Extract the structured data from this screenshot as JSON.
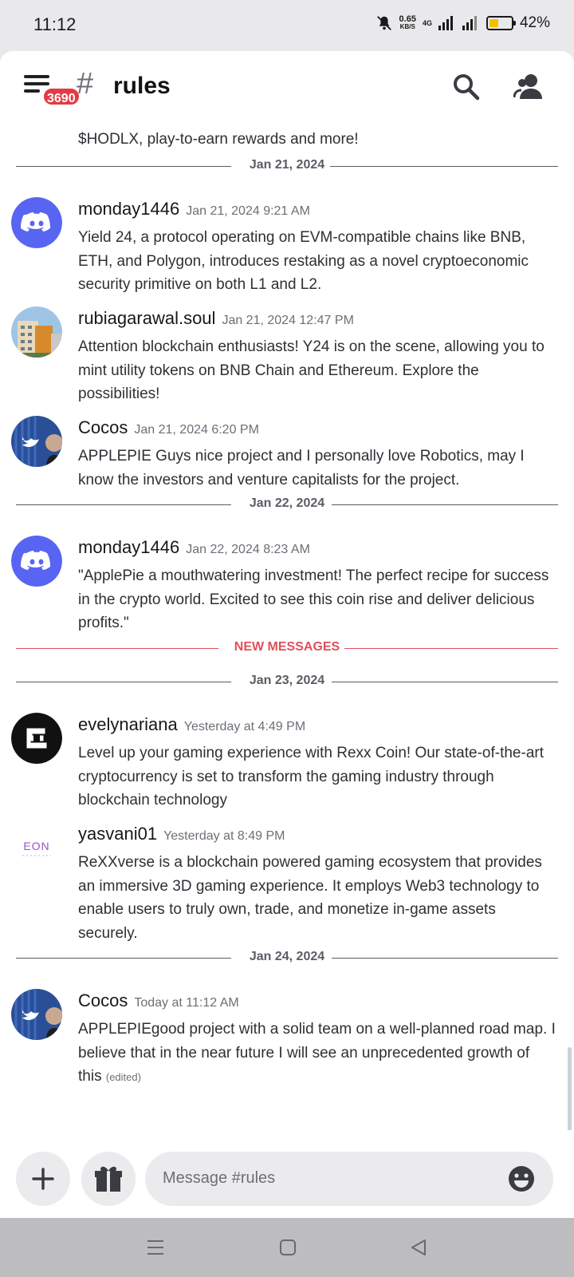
{
  "status_bar": {
    "time": "11:12",
    "net_speed": "0.65",
    "net_unit": "KB/S",
    "network": "4G",
    "battery_percent": "42%",
    "battery_level": 0.42
  },
  "header": {
    "unread_badge": "3690",
    "hash": "#",
    "channel_name": "rules"
  },
  "continuation_text": "$HODLX, play-to-earn rewards and more!",
  "dividers": {
    "d1": "Jan 21, 2024",
    "d2": "Jan 22, 2024",
    "new_messages": "NEW MESSAGES",
    "d3": "Jan 23, 2024",
    "d4": "Jan 24, 2024"
  },
  "messages": [
    {
      "author": "monday1446",
      "timestamp": "Jan 21, 2024 9:21 AM",
      "text": "Yield 24, a protocol operating on EVM-compatible chains like BNB, ETH, and Polygon, introduces restaking as a novel cryptoeconomic security primitive on both L1 and L2."
    },
    {
      "author": "rubiagarawal.soul",
      "timestamp": "Jan 21, 2024 12:47 PM",
      "text": "Attention blockchain enthusiasts! Y24 is on the scene, allowing you to mint utility tokens on BNB Chain and Ethereum. Explore the possibilities!"
    },
    {
      "author": "Cocos",
      "timestamp": "Jan 21, 2024 6:20 PM",
      "text": "APPLEPIE Guys nice project and I personally love Robotics, may I know the investors and venture capitalists for the project."
    },
    {
      "author": "monday1446",
      "timestamp": "Jan 22, 2024 8:23 AM",
      "text": "\"ApplePie  a mouthwatering investment! The perfect recipe for success in the crypto world. Excited to see this coin rise and deliver delicious profits.\""
    },
    {
      "author": "evelynariana",
      "timestamp": "Yesterday at 4:49 PM",
      "text": "Level up your gaming experience with Rexx Coin! Our state-of-the-art cryptocurrency is set to transform the gaming industry through blockchain technology"
    },
    {
      "author": "yasvani01",
      "timestamp": "Yesterday at 8:49 PM",
      "avatar_text": "EON",
      "text": "ReXXverse is a blockchain powered gaming ecosystem that provides an immersive 3D gaming experience. It employs Web3 technology to enable users to truly own, trade, and monetize in-game assets securely."
    },
    {
      "author": "Cocos",
      "timestamp": "Today at 11:12 AM",
      "text": "APPLEPIEgood project with a solid team on a well-planned road map. I believe that in the near future I will see an unprecedented growth of this",
      "edited": "(edited)"
    }
  ],
  "composer": {
    "placeholder": "Message #rules"
  },
  "icons": [
    "menu-icon",
    "search-icon",
    "members-icon",
    "plus-icon",
    "gift-icon",
    "emoji-icon",
    "discord-icon",
    "recents-icon",
    "home-icon",
    "back-icon"
  ],
  "colors": {
    "accent_blurple": "#5865f2",
    "new_messages_red": "#e0505a",
    "badge_red": "#e23b45"
  }
}
